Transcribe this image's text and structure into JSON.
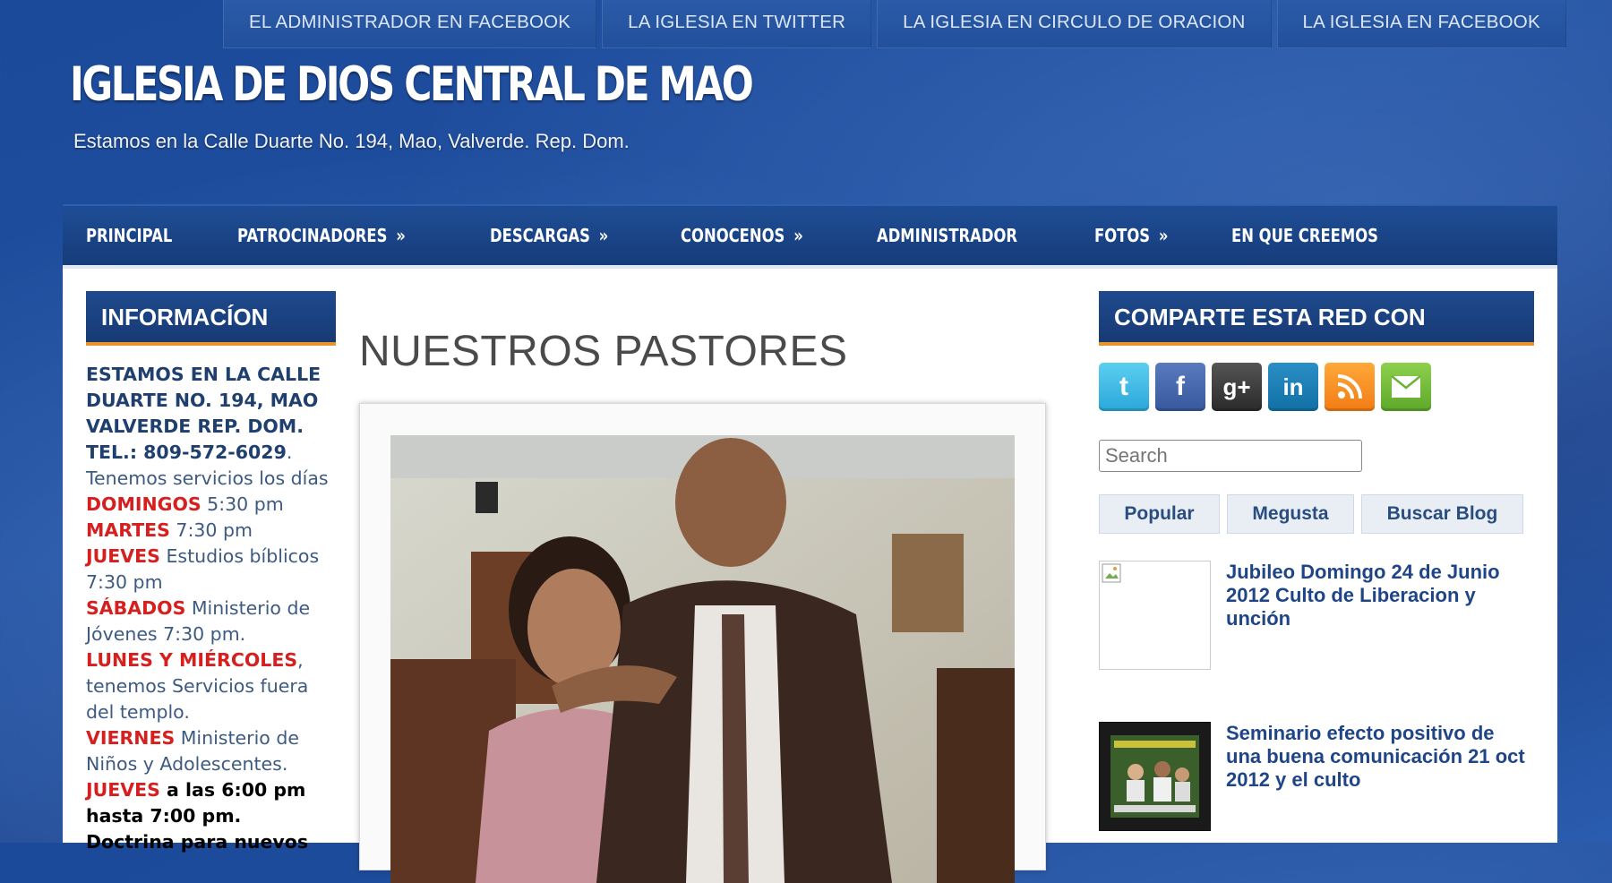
{
  "top_links": [
    "EL ADMINISTRADOR EN FACEBOOK",
    "LA IGLESIA EN TWITTER",
    "LA IGLESIA EN CIRCULO DE ORACION",
    "LA IGLESIA EN FACEBOOK"
  ],
  "site": {
    "title": "IGLESIA DE DIOS CENTRAL DE MAO",
    "description": "Estamos en la Calle Duarte No. 194, Mao, Valverde. Rep. Dom."
  },
  "nav": {
    "principal": "PRINCIPAL",
    "patrocinadores": "PATROCINADORES",
    "descargas": "DESCARGAS",
    "conocenos": "CONOCENOS",
    "administrador": "ADMINISTRADOR",
    "fotos": "FOTOS",
    "creemos": "EN QUE CREEMOS",
    "arrow": "»"
  },
  "info_widget": {
    "title": "INFORMACÍON",
    "address": "ESTAMOS EN LA CALLE DUARTE NO. 194, MAO VALVERDE REP. DOM.",
    "phone": "TEL.: 809-572-6029",
    "phone_end": ".",
    "services_intro": "Tenemos servicios los días",
    "day1": "DOMINGOS",
    "day1_text": " 5:30 pm",
    "day2": "MARTES",
    "day2_text": " 7:30 pm",
    "day3": "JUEVES",
    "day3_text": " Estudios bíblicos 7:30 pm",
    "day4": "SÁBADOS",
    "day4_text": " Ministerio de Jóvenes 7:30 pm.",
    "day5": "LUNES Y MIÉRCOLES",
    "day5_text": ", tenemos Servicios fuera del templo.",
    "day6": "VIERNES",
    "day6_text": " Ministerio de Niños y Adolescentes.",
    "day7": "JUEVES",
    "day7_text": " a las 6:00 pm hasta 7:00 pm.",
    "last_line": "Doctrina para nuevos"
  },
  "post": {
    "title": "NUESTROS PASTORES"
  },
  "share_widget": {
    "title": "COMPARTE ESTA RED CON",
    "search_placeholder": "Search",
    "tabs": [
      "Popular",
      "Megusta",
      "Buscar Blog"
    ],
    "posts": [
      "Jubileo Domingo 24 de Junio 2012 Culto de Liberacion y unción",
      "Seminario efecto positivo de una buena comunicación 21 oct 2012 y el culto"
    ]
  }
}
